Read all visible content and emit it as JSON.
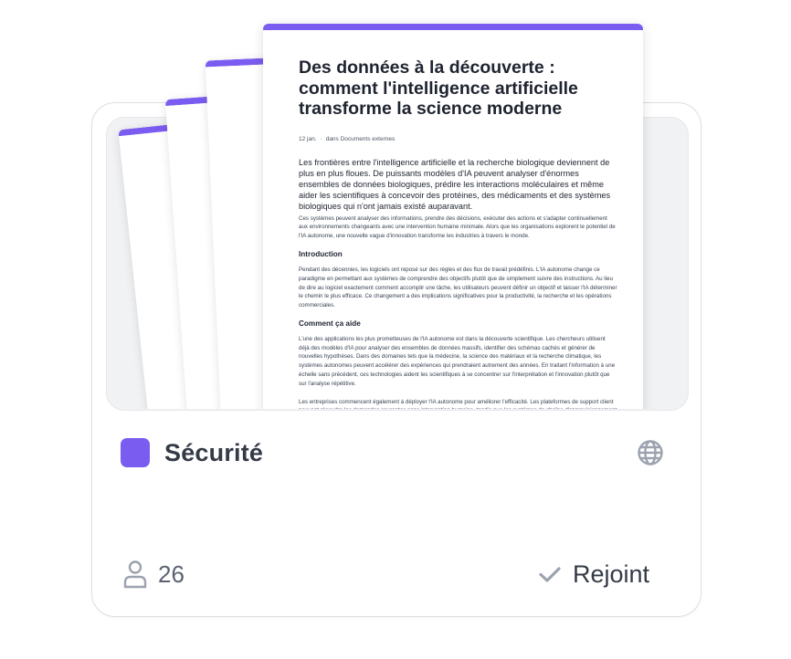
{
  "document": {
    "title": "Des données à la découverte : comment l'intelligence artificielle transforme la science moderne",
    "date": "12 jan.",
    "meta_separator": "·",
    "source": "dans Documents externes",
    "lead": "Les frontières entre l'intelligence artificielle et la recherche biologique deviennent de plus en plus floues. De puissants modèles d'IA peuvent analyser d'énormes ensembles de données biologiques, prédire les interactions moléculaires et même aider les scientifiques à concevoir des protéines, des médicaments et des systèmes biologiques qui n'ont jamais existé auparavant.",
    "intro_paragraph": "Ces systèmes peuvent analyser des informations, prendre des décisions, exécuter des actions et s'adapter continuellement aux environnements changeants avec une intervention humaine minimale. Alors que les organisations explorent le potentiel de l'IA autonome, une nouvelle vague d'innovation transforme les industries à travers le monde.",
    "section1_heading": "Introduction",
    "section1_text": "Pendant des décennies, les logiciels ont reposé sur des règles et des flux de travail prédéfinis. L'IA autonome change ce paradigme en permettant aux systèmes de comprendre des objectifs plutôt que de simplement suivre des instructions. Au lieu de dire au logiciel exactement comment accomplir une tâche, les utilisateurs peuvent définir un objectif et laisser l'IA déterminer le chemin le plus efficace. Ce changement a des implications significatives pour la productivité, la recherche et les opérations commerciales.",
    "section2_heading": "Comment ça aide",
    "section2_text": "L'une des applications les plus prometteuses de l'IA autonome est dans la découverte scientifique. Les chercheurs utilisent déjà des modèles d'IA pour analyser des ensembles de données massifs, identifier des schémas cachés et générer de nouvelles hypothèses. Dans des domaines tels que la médecine, la science des matériaux et la recherche climatique, les systèmes autonomes peuvent accélérer des expériences qui prendraient autrement des années. En traitant l'information à une échelle sans précédent, ces technologies aident les scientifiques à se concentrer sur l'interprétation et l'innovation plutôt que sur l'analyse répétitive.",
    "section2_text2": "Les entreprises commencent également à déployer l'IA autonome pour améliorer l'efficacité. Les plateformes de support client peuvent résoudre les demandes courantes sans intervention humaine, tandis que les systèmes de chaîne d'approvisionnement ajustent dynamiquement les niveaux de stock en fonction de la demande en temps réel. En"
  },
  "card": {
    "title": "Sécurité",
    "member_count": "26",
    "join_label": "Rejoint"
  },
  "icons": {
    "visibility": "globe-icon",
    "members": "user-icon",
    "joined": "check-icon"
  },
  "colors": {
    "accent": "#7b5cf0",
    "preview_bg": "#f1f2f4",
    "title_text": "#343a46",
    "muted_icon": "#9ca3af"
  }
}
